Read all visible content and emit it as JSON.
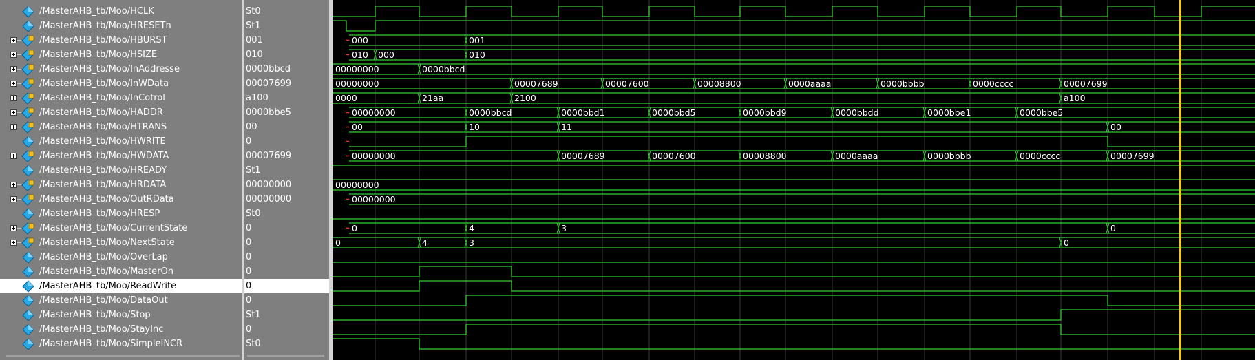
{
  "colors": {
    "wave": "#33cc33",
    "cursor": "#ffcc00",
    "grid": "#3a3a3a",
    "undriven": "#ff3333",
    "pane_bg": "#7f7f7f"
  },
  "signals": [
    {
      "name": "/MasterAHB_tb/Moo/HCLK",
      "value": "St0",
      "expandable": false
    },
    {
      "name": "/MasterAHB_tb/Moo/HRESETn",
      "value": "St1",
      "expandable": false
    },
    {
      "name": "/MasterAHB_tb/Moo/HBURST",
      "value": "001",
      "expandable": true
    },
    {
      "name": "/MasterAHB_tb/Moo/HSIZE",
      "value": "010",
      "expandable": true
    },
    {
      "name": "/MasterAHB_tb/Moo/InAddresse",
      "value": "0000bbcd",
      "expandable": true
    },
    {
      "name": "/MasterAHB_tb/Moo/InWData",
      "value": "00007699",
      "expandable": true
    },
    {
      "name": "/MasterAHB_tb/Moo/InCotrol",
      "value": "a100",
      "expandable": true
    },
    {
      "name": "/MasterAHB_tb/Moo/HADDR",
      "value": "0000bbe5",
      "expandable": true
    },
    {
      "name": "/MasterAHB_tb/Moo/HTRANS",
      "value": "00",
      "expandable": true
    },
    {
      "name": "/MasterAHB_tb/Moo/HWRITE",
      "value": "0",
      "expandable": false
    },
    {
      "name": "/MasterAHB_tb/Moo/HWDATA",
      "value": "00007699",
      "expandable": true
    },
    {
      "name": "/MasterAHB_tb/Moo/HREADY",
      "value": "St1",
      "expandable": false
    },
    {
      "name": "/MasterAHB_tb/Moo/HRDATA",
      "value": "00000000",
      "expandable": true
    },
    {
      "name": "/MasterAHB_tb/Moo/OutRData",
      "value": "00000000",
      "expandable": true
    },
    {
      "name": "/MasterAHB_tb/Moo/HRESP",
      "value": "St0",
      "expandable": false
    },
    {
      "name": "/MasterAHB_tb/Moo/CurrentState",
      "value": "0",
      "expandable": true
    },
    {
      "name": "/MasterAHB_tb/Moo/NextState",
      "value": "0",
      "expandable": true
    },
    {
      "name": "/MasterAHB_tb/Moo/OverLap",
      "value": "0",
      "expandable": false
    },
    {
      "name": "/MasterAHB_tb/Moo/MasterOn",
      "value": "0",
      "expandable": false
    },
    {
      "name": "/MasterAHB_tb/Moo/ReadWrite",
      "value": "0",
      "expandable": false,
      "selected": true
    },
    {
      "name": "/MasterAHB_tb/Moo/DataOut",
      "value": "0",
      "expandable": false
    },
    {
      "name": "/MasterAHB_tb/Moo/Stop",
      "value": "St1",
      "expandable": false
    },
    {
      "name": "/MasterAHB_tb/Moo/StayInc",
      "value": "0",
      "expandable": false
    },
    {
      "name": "/MasterAHB_tb/Moo/SimpleINCR",
      "value": "St0",
      "expandable": false
    }
  ],
  "waveforms": {
    "bus_labels": [
      {
        "row": 2,
        "labels": [
          "000",
          "001"
        ]
      },
      {
        "row": 3,
        "labels": [
          "010",
          "000",
          "010"
        ]
      },
      {
        "row": 4,
        "labels": [
          "00000000",
          "0000bbcd"
        ]
      },
      {
        "row": 5,
        "labels": [
          "00000000",
          "00007689",
          "00007600",
          "00008800",
          "0000aaaa",
          "0000bbbb",
          "0000cccc",
          "00007699"
        ]
      },
      {
        "row": 6,
        "labels": [
          "0000",
          "21aa",
          "2100",
          "a100"
        ]
      },
      {
        "row": 7,
        "labels": [
          "00000000",
          "0000bbcd",
          "0000bbd1",
          "0000bbd5",
          "0000bbd9",
          "0000bbdd",
          "0000bbe1",
          "0000bbe5"
        ]
      },
      {
        "row": 8,
        "labels": [
          "00",
          "10",
          "11",
          "00"
        ]
      },
      {
        "row": 10,
        "labels": [
          "00000000",
          "00007689",
          "00007600",
          "00008800",
          "0000aaaa",
          "0000bbbb",
          "0000cccc",
          "00007699"
        ]
      },
      {
        "row": 12,
        "labels": [
          "00000000"
        ]
      },
      {
        "row": 13,
        "labels": [
          "00000000"
        ]
      },
      {
        "row": 15,
        "labels": [
          "0",
          "4",
          "3",
          "0"
        ]
      },
      {
        "row": 16,
        "labels": [
          "0",
          "4",
          "3",
          "0"
        ]
      }
    ]
  }
}
